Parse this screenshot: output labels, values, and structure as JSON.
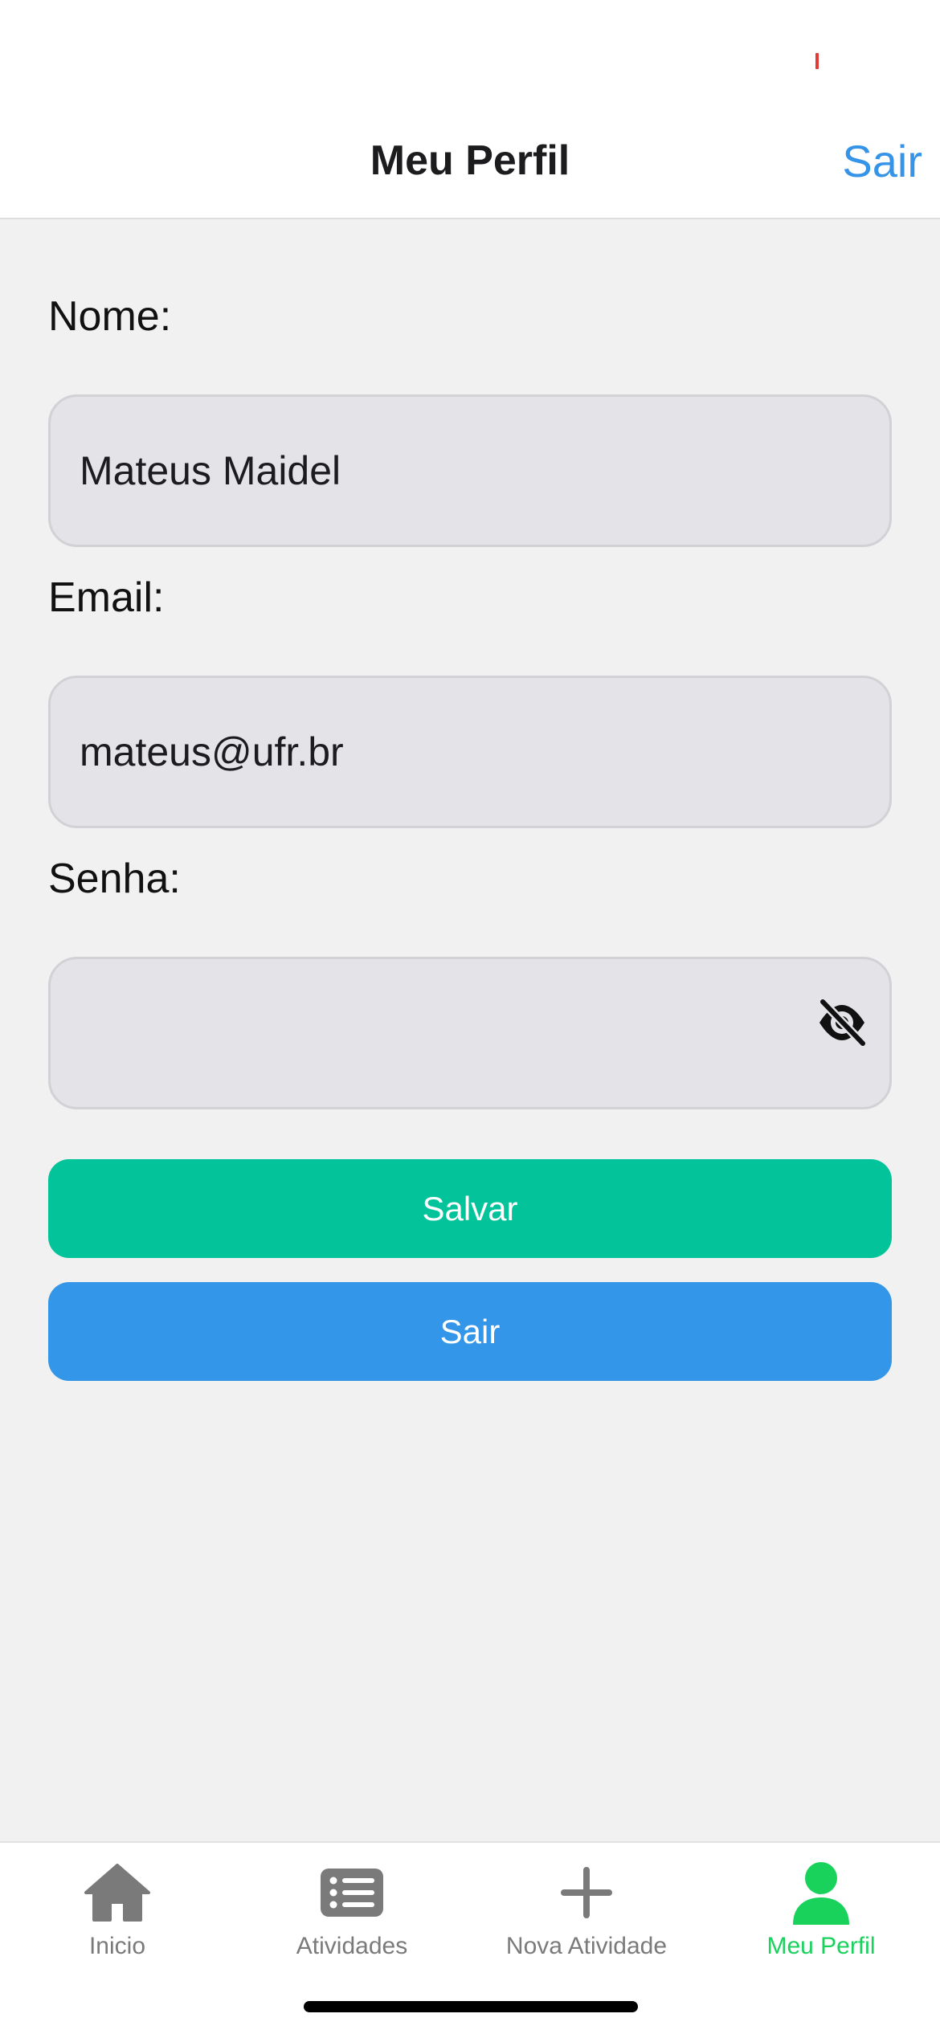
{
  "header": {
    "title": "Meu Perfil",
    "action_label": "Sair"
  },
  "form": {
    "name_label": "Nome:",
    "name_value": "Mateus Maidel",
    "email_label": "Email:",
    "email_value": "mateus@ufr.br",
    "password_label": "Senha:",
    "password_value": "",
    "password_toggle_icon": "eye-off-icon"
  },
  "buttons": {
    "save_label": "Salvar",
    "save_color": "#02c39a",
    "logout_label": "Sair",
    "logout_color": "#3396e8"
  },
  "tabbar": {
    "active_color": "#18d25c",
    "inactive_color": "#7a7a7a",
    "items": [
      {
        "label": "Inicio",
        "icon": "home-icon",
        "active": false
      },
      {
        "label": "Atividades",
        "icon": "list-icon",
        "active": false
      },
      {
        "label": "Nova Atividade",
        "icon": "plus-icon",
        "active": false
      },
      {
        "label": "Meu Perfil",
        "icon": "user-icon",
        "active": true
      }
    ]
  }
}
